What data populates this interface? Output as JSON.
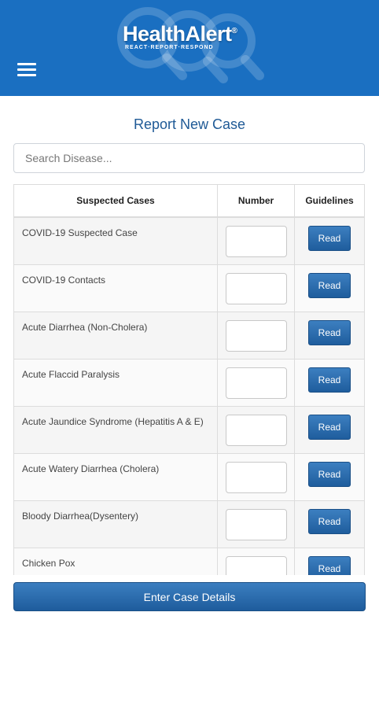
{
  "header": {
    "logo_text": "HealthAlert",
    "logo_reg": "®",
    "tagline": "REACT·REPORT·RESPOND",
    "menu_icon": "hamburger-menu-icon",
    "colors": {
      "background": "#1a6fc1"
    }
  },
  "page": {
    "title": "Report New Case",
    "title_color": "#1f5a96"
  },
  "search": {
    "placeholder": "Search Disease...",
    "value": ""
  },
  "table": {
    "columns": [
      "Suspected Cases",
      "Number",
      "Guidelines"
    ],
    "rows": [
      {
        "name": "COVID-19 Suspected Case",
        "number": "",
        "action": "Read"
      },
      {
        "name": "COVID-19 Contacts",
        "number": "",
        "action": "Read"
      },
      {
        "name": "Acute Diarrhea (Non-Cholera)",
        "number": "",
        "action": "Read"
      },
      {
        "name": "Acute Flaccid Paralysis",
        "number": "",
        "action": "Read"
      },
      {
        "name": "Acute Jaundice Syndrome (Hepatitis A & E)",
        "number": "",
        "action": "Read"
      },
      {
        "name": "Acute Watery Diarrhea (Cholera)",
        "number": "",
        "action": "Read"
      },
      {
        "name": "Bloody Diarrhea(Dysentery)",
        "number": "",
        "action": "Read"
      },
      {
        "name": "Chicken Pox",
        "number": "",
        "action": "Read"
      }
    ]
  },
  "footer": {
    "submit_label": "Enter Case Details",
    "button_color": "#1f5d9d"
  }
}
